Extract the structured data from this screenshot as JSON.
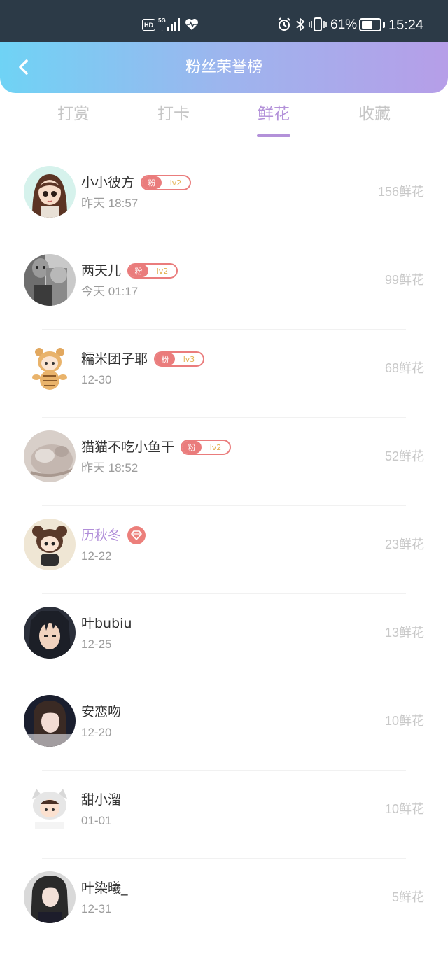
{
  "status_bar": {
    "hd": "HD",
    "battery_percent": "61%",
    "battery_level": 0.61,
    "time": "15:24"
  },
  "header": {
    "back_icon": "chevron-left-icon",
    "title": "粉丝荣誉榜"
  },
  "tabs": [
    {
      "label": "打赏",
      "active": false
    },
    {
      "label": "打卡",
      "active": false
    },
    {
      "label": "鲜花",
      "active": true
    },
    {
      "label": "收藏",
      "active": false
    }
  ],
  "colors": {
    "accent": "#b391d9",
    "fan_badge": "#ea7c7c",
    "level_text": "#e2b04f",
    "header_start": "#6fd3f5",
    "header_end": "#b69ee8"
  },
  "list": [
    {
      "name": "小小彼方",
      "time": "昨天 18:57",
      "count": "156鲜花",
      "badge": {
        "type": "fan",
        "label": "粉",
        "level": "lv2"
      }
    },
    {
      "name": "两天儿",
      "time": "今天 01:17",
      "count": "99鲜花",
      "badge": {
        "type": "fan",
        "label": "粉",
        "level": "lv2"
      }
    },
    {
      "name": "糯米团子耶",
      "time": "12-30",
      "count": "68鲜花",
      "badge": {
        "type": "fan",
        "label": "粉",
        "level": "lv3"
      }
    },
    {
      "name": "猫猫不吃小鱼干",
      "time": "昨天 18:52",
      "count": "52鲜花",
      "badge": {
        "type": "fan",
        "label": "粉",
        "level": "lv2"
      }
    },
    {
      "name": "历秋冬",
      "time": "12-22",
      "count": "23鲜花",
      "badge": {
        "type": "diamond"
      }
    },
    {
      "name": "叶bubiu",
      "time": "12-25",
      "count": "13鲜花"
    },
    {
      "name": "安恋吻",
      "time": "12-20",
      "count": "10鲜花"
    },
    {
      "name": "甜小溜",
      "time": "01-01",
      "count": "10鲜花"
    },
    {
      "name": "叶染曦_",
      "time": "12-31",
      "count": "5鲜花"
    }
  ]
}
